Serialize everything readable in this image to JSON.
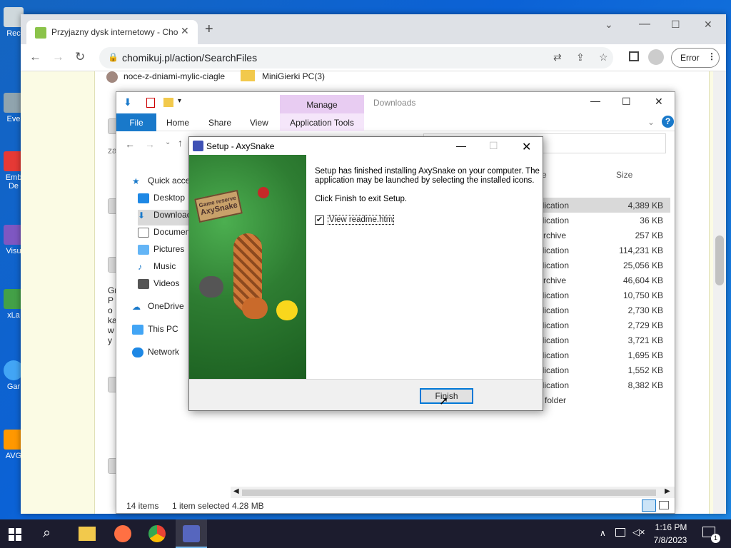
{
  "desktop": {
    "icons": [
      {
        "label": "Rec"
      },
      {
        "label": "Eve"
      },
      {
        "label": "Emb De"
      },
      {
        "label": "Visu"
      },
      {
        "label": "xLa"
      },
      {
        "label": "Gar"
      },
      {
        "label": "AVG"
      }
    ]
  },
  "browser": {
    "tab_title": "Przyjazny dysk internetowy - Cho",
    "url": "chomikuj.pl/action/SearchFiles",
    "error_label": "Error",
    "page": {
      "folder1": "noce-z-dniami-mylic-ciagle",
      "folder2": "MiniGierki PC(3)",
      "side_text1": "za",
      "side_text2": "Gr Po ka wy"
    }
  },
  "explorer": {
    "manage_tab": "Manage",
    "window_title": "Downloads",
    "ribbon": {
      "file": "File",
      "home": "Home",
      "share": "Share",
      "view": "View",
      "app_tools": "Application Tools"
    },
    "nav": {
      "quick_access": "Quick acce",
      "desktop": "Desktop",
      "downloads": "Download",
      "documents": "Documen",
      "pictures": "Pictures",
      "music": "Music",
      "videos": "Videos",
      "onedrive": "OneDrive",
      "this_pc": "This PC",
      "network": "Network"
    },
    "columns": {
      "type": "e",
      "size": "Size"
    },
    "files": [
      {
        "type": "plication",
        "size": "4,389 KB",
        "selected": true
      },
      {
        "type": "plication",
        "size": "36 KB"
      },
      {
        "type": "Archive",
        "size": "257 KB"
      },
      {
        "type": "plication",
        "size": "114,231 KB"
      },
      {
        "type": "plication",
        "size": "25,056 KB"
      },
      {
        "type": "Archive",
        "size": "46,604 KB"
      },
      {
        "type": "plication",
        "size": "10,750 KB"
      },
      {
        "type": "plication",
        "size": "2,730 KB"
      },
      {
        "type": "plication",
        "size": "2,729 KB"
      },
      {
        "type": "plication",
        "size": "3,721 KB"
      },
      {
        "type": "plication",
        "size": "1,695 KB"
      },
      {
        "type": "plication",
        "size": "1,552 KB"
      },
      {
        "type": "plication",
        "size": "8,382 KB"
      },
      {
        "type": "e folder",
        "size": ""
      }
    ],
    "status": {
      "items": "14 items",
      "selected": "1 item selected",
      "size": "4.28 MB"
    }
  },
  "setup": {
    "title": "Setup - AxySnake",
    "line1": "Setup has finished installing AxySnake on your computer. The",
    "line2": "application may be launched by selecting the installed icons.",
    "line3": "Click Finish to exit Setup.",
    "readme_label": "View readme.htm",
    "readme_checked": "✔",
    "finish_label": "Finish",
    "banner_sign1": "Game reserve",
    "banner_sign2": "AxySnake"
  },
  "taskbar": {
    "time": "1:16 PM",
    "date": "7/8/2023",
    "notif_count": "1"
  }
}
